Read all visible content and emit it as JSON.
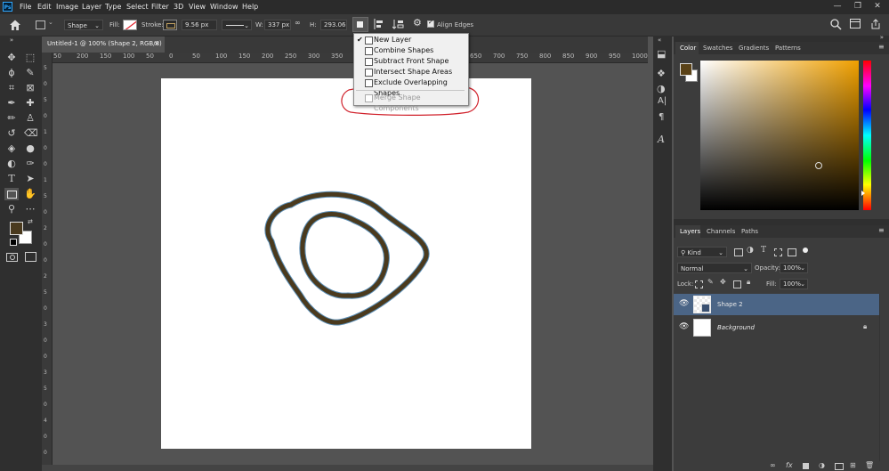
{
  "menu": [
    "File",
    "Edit",
    "Image",
    "Layer",
    "Type",
    "Select",
    "Filter",
    "3D",
    "View",
    "Window",
    "Help"
  ],
  "window_controls": {
    "minimize": "—",
    "maximize": "❐",
    "close": "✕"
  },
  "options_bar": {
    "mode": "Shape",
    "fill_label": "Fill:",
    "stroke_label": "Stroke:",
    "stroke_size": "9.56 px",
    "w_label": "W:",
    "w_value": "337 px",
    "h_label": "H:",
    "h_value": "293.06",
    "align_edges": "Align Edges",
    "stroke_color": "#4a3a1e"
  },
  "document_tab": {
    "title": "Untitled-1 @ 100% (Shape 2, RGB/8) *",
    "close": "×"
  },
  "ruler_h": [
    "50",
    "200",
    "150",
    "100",
    "50",
    "0",
    "50",
    "100",
    "150",
    "200",
    "250",
    "300",
    "350",
    "400",
    "450",
    "500",
    "550",
    "600",
    "650",
    "700",
    "750",
    "800",
    "850",
    "900",
    "950",
    "1000"
  ],
  "ruler_v": [
    "5",
    "0",
    "5",
    "0",
    "1",
    "0",
    "0",
    "1",
    "5",
    "0",
    "2",
    "0",
    "0",
    "2",
    "5",
    "0",
    "3",
    "0",
    "0",
    "3",
    "5",
    "0",
    "4",
    "0",
    "0"
  ],
  "path_operations": {
    "items": [
      {
        "label": "New Layer",
        "checked": "✔",
        "disabled": false
      },
      {
        "label": "Combine Shapes",
        "checked": "",
        "disabled": false
      },
      {
        "label": "Subtract Front Shape",
        "checked": "",
        "disabled": false
      },
      {
        "label": "Intersect Shape Areas",
        "checked": "",
        "disabled": false
      },
      {
        "label": "Exclude Overlapping Shapes",
        "checked": "",
        "disabled": false
      },
      {
        "label": "Merge Shape Components",
        "checked": "",
        "disabled": true
      }
    ]
  },
  "color_panel": {
    "tabs": [
      "Color",
      "Swatches",
      "Gradients",
      "Patterns"
    ],
    "foreground": "#5a4217",
    "background": "#ffffff",
    "hue": "#f0a000"
  },
  "layers_panel": {
    "tabs": [
      "Layers",
      "Channels",
      "Paths"
    ],
    "filter_kind": "Kind",
    "blend_mode": "Normal",
    "opacity_label": "Opacity:",
    "opacity_value": "100%",
    "lock_label": "Lock:",
    "fill_label": "Fill:",
    "fill_value": "100%",
    "layers": [
      {
        "name": "Shape 2",
        "selected": true
      },
      {
        "name": "Background",
        "selected": false
      }
    ]
  },
  "annotation_color": "#d0202a",
  "shape_stroke_color": "#4a3a1e",
  "shape_outline_color": "#5b8fb8"
}
